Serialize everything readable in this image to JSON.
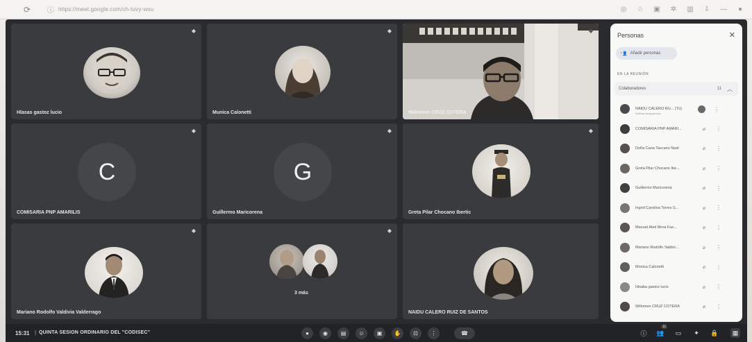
{
  "browser": {
    "url": "https://meet.google.com/ch-tuvy-wsu"
  },
  "tiles": [
    {
      "name": "Hlasas gastoz lucio",
      "kind": "photo"
    },
    {
      "name": "Munica Calonetti",
      "kind": "photo"
    },
    {
      "name": "Wilinmen CRUZ COTERA",
      "kind": "video"
    },
    {
      "name": "COMISARIA PNP AMARILIS",
      "kind": "letter",
      "letter": "C"
    },
    {
      "name": "Guillermo Maricorena",
      "kind": "letter",
      "letter": "G"
    },
    {
      "name": "Greta Pilar Chocano Ibertic",
      "kind": "photo"
    },
    {
      "name": "Mariano Rodolfo Valdivia Valderrago",
      "kind": "photo"
    },
    {
      "name": "3 más",
      "kind": "group"
    },
    {
      "name": "NAIDU CALERO RUIZ DE SANTOS",
      "kind": "photo"
    }
  ],
  "panel": {
    "title": "Personas",
    "add_label": "Añadir personas",
    "section": "EN LA REUNIÓN",
    "group_label": "Colaboradores",
    "group_count": "11",
    "participants": [
      {
        "name": "NAIDU CALERO RU... (Tú)",
        "sub": "Notificas designaciones",
        "color": "#4a4a4e"
      },
      {
        "name": "COMISARIA PNP AMARI...",
        "color": "#3d3d40"
      },
      {
        "name": "Doña Cana Tascano Neal",
        "color": "#55524e"
      },
      {
        "name": "Greta Pilar Chocano Ibe...",
        "color": "#6b6660"
      },
      {
        "name": "Guillermo Maricorena",
        "color": "#3f3f42"
      },
      {
        "name": "Ingrid Carolina Torres S...",
        "color": "#7a7570"
      },
      {
        "name": "Manuel Abel Mora Fue...",
        "color": "#5a5652"
      },
      {
        "name": "Mariano Rodolfo Valdivi...",
        "color": "#6d6863"
      },
      {
        "name": "Monica Calonetti",
        "color": "#625e59"
      },
      {
        "name": "Hlsaba gastoz lucio",
        "color": "#8b8782"
      },
      {
        "name": "Wilinmen CRUZ COTERA",
        "color": "#4d4a47"
      }
    ]
  },
  "bottombar": {
    "time": "15:31",
    "separator": "|",
    "meeting_title": "QUINTA SESION ORDINARIO DEL \"CODISEC\"",
    "people_count": "11"
  }
}
